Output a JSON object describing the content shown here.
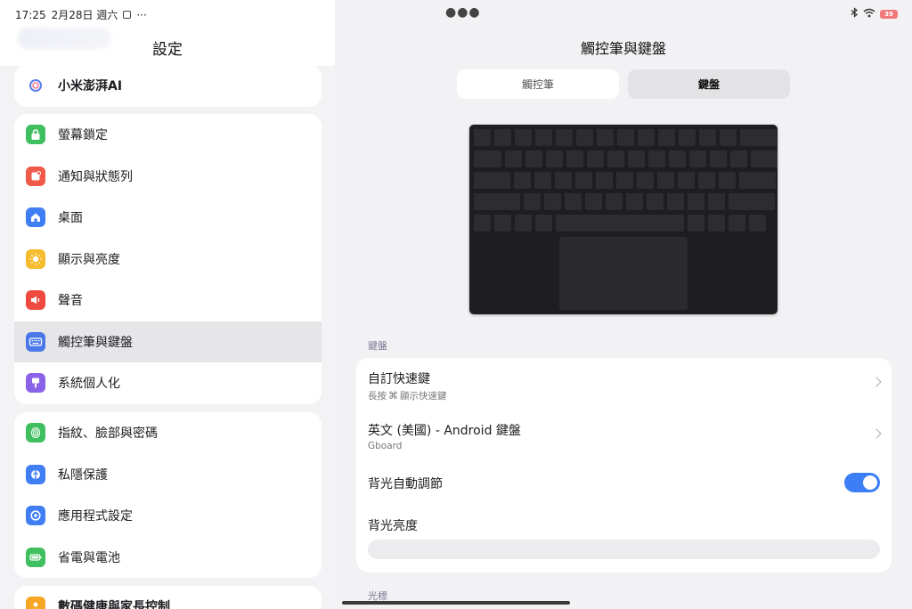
{
  "status": {
    "time": "17:25",
    "date": "2月28日 週六",
    "more": "···",
    "battery": "39"
  },
  "left": {
    "title": "設定",
    "groups": [
      {
        "items": [
          {
            "label": "小米澎湃AI",
            "icon": "ai-icon",
            "bold": true
          }
        ]
      },
      {
        "items": [
          {
            "label": "螢幕鎖定",
            "icon": "lock-icon",
            "color": "#3fbf5f"
          },
          {
            "label": "通知與狀態列",
            "icon": "notification-icon",
            "color": "#f05a4a"
          },
          {
            "label": "桌面",
            "icon": "home-icon",
            "color": "#3f7ef3"
          },
          {
            "label": "顯示與亮度",
            "icon": "sun-icon",
            "color": "#f5bd2e"
          },
          {
            "label": "聲音",
            "icon": "speaker-icon",
            "color": "#ee4a3f"
          },
          {
            "label": "觸控筆與鍵盤",
            "icon": "keyboard-icon",
            "color": "#4a78e8",
            "selected": true
          },
          {
            "label": "系統個人化",
            "icon": "brush-icon",
            "color": "#8a63e8"
          }
        ]
      },
      {
        "items": [
          {
            "label": "指紋、臉部與密碼",
            "icon": "fingerprint-icon",
            "color": "#3fbf5f"
          },
          {
            "label": "私隱保護",
            "icon": "privacy-icon",
            "color": "#3f7ef3"
          },
          {
            "label": "應用程式設定",
            "icon": "app-settings-icon",
            "color": "#3f7ef3"
          },
          {
            "label": "省電與電池",
            "icon": "battery-icon",
            "color": "#3fbf5f"
          }
        ]
      },
      {
        "items": [
          {
            "label": "數碼健康與家長控制",
            "icon": "wellbeing-icon",
            "color": "#f5a623"
          }
        ]
      }
    ]
  },
  "right": {
    "title": "觸控筆與鍵盤",
    "tabs": [
      {
        "label": "觸控筆",
        "active": false
      },
      {
        "label": "鍵盤",
        "active": true
      }
    ],
    "section_keyboard": "鍵盤",
    "rows": {
      "shortcuts": {
        "title": "自訂快速鍵",
        "sub_prefix": "長按",
        "sub_icon": "⌘",
        "sub_suffix": "顯示快速鍵"
      },
      "keyboard": {
        "title": "英文 (美國) - Android 鍵盤",
        "sub": "Gboard"
      },
      "auto_backlight": {
        "title": "背光自動調節",
        "on": true
      },
      "brightness": {
        "title": "背光亮度"
      }
    },
    "section_cursor": "光標"
  }
}
